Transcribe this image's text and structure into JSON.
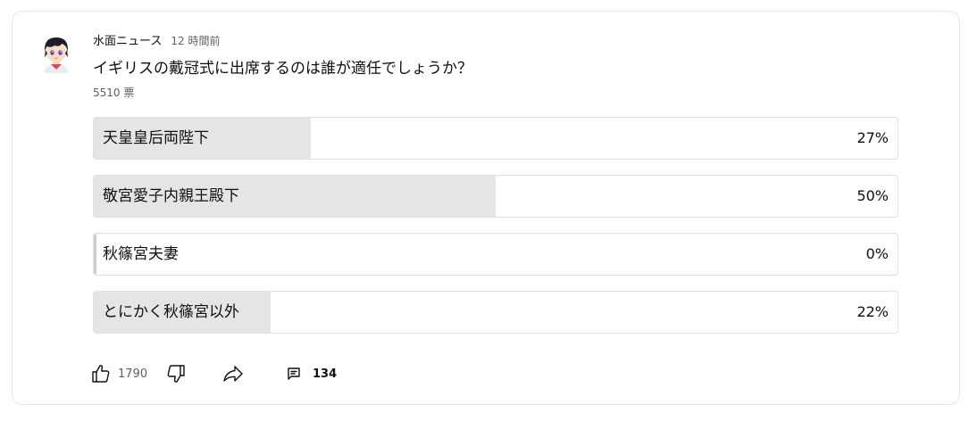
{
  "post": {
    "channel_name": "水面ニュース",
    "time_ago": "12 時間前",
    "question": "イギリスの戴冠式に出席するのは誰が適任でしょうか？",
    "vote_count": "5510 票"
  },
  "poll": {
    "options": [
      {
        "label": "天皇皇后両陛下",
        "percent_text": "27%",
        "percent": 27
      },
      {
        "label": "敬宮愛子内親王殿下",
        "percent_text": "50%",
        "percent": 50
      },
      {
        "label": "秋篠宮夫妻",
        "percent_text": "0%",
        "percent": 0
      },
      {
        "label": "とにかく秋篠宮以外",
        "percent_text": "22%",
        "percent": 22
      }
    ]
  },
  "toolbar": {
    "like_count": "1790",
    "comment_count": "134",
    "icons": [
      "thumbs-up-icon",
      "thumbs-down-icon",
      "share-icon",
      "comment-icon"
    ]
  },
  "colors": {
    "fill": "#e5e5e5",
    "border": "#e0e0e0",
    "text": "#0f0f0f",
    "secondary_text": "#606060"
  }
}
